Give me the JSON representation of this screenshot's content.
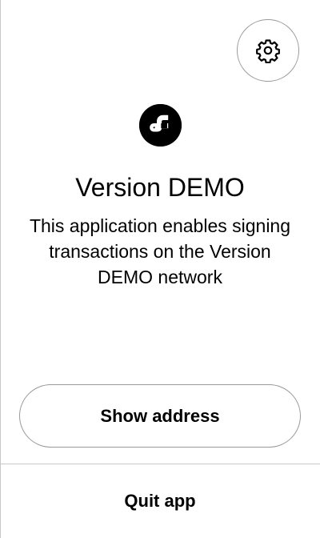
{
  "header": {
    "settings_icon": "gear-icon"
  },
  "app": {
    "logo_icon": "app-logo-icon",
    "title": "Version DEMO",
    "description": "This application enables signing transactions on the Version DEMO network"
  },
  "actions": {
    "show_address_label": "Show address",
    "quit_label": "Quit app"
  },
  "colors": {
    "background": "#ffffff",
    "text": "#000000",
    "border": "#9a9a9a",
    "divider": "#c8c8c8"
  }
}
